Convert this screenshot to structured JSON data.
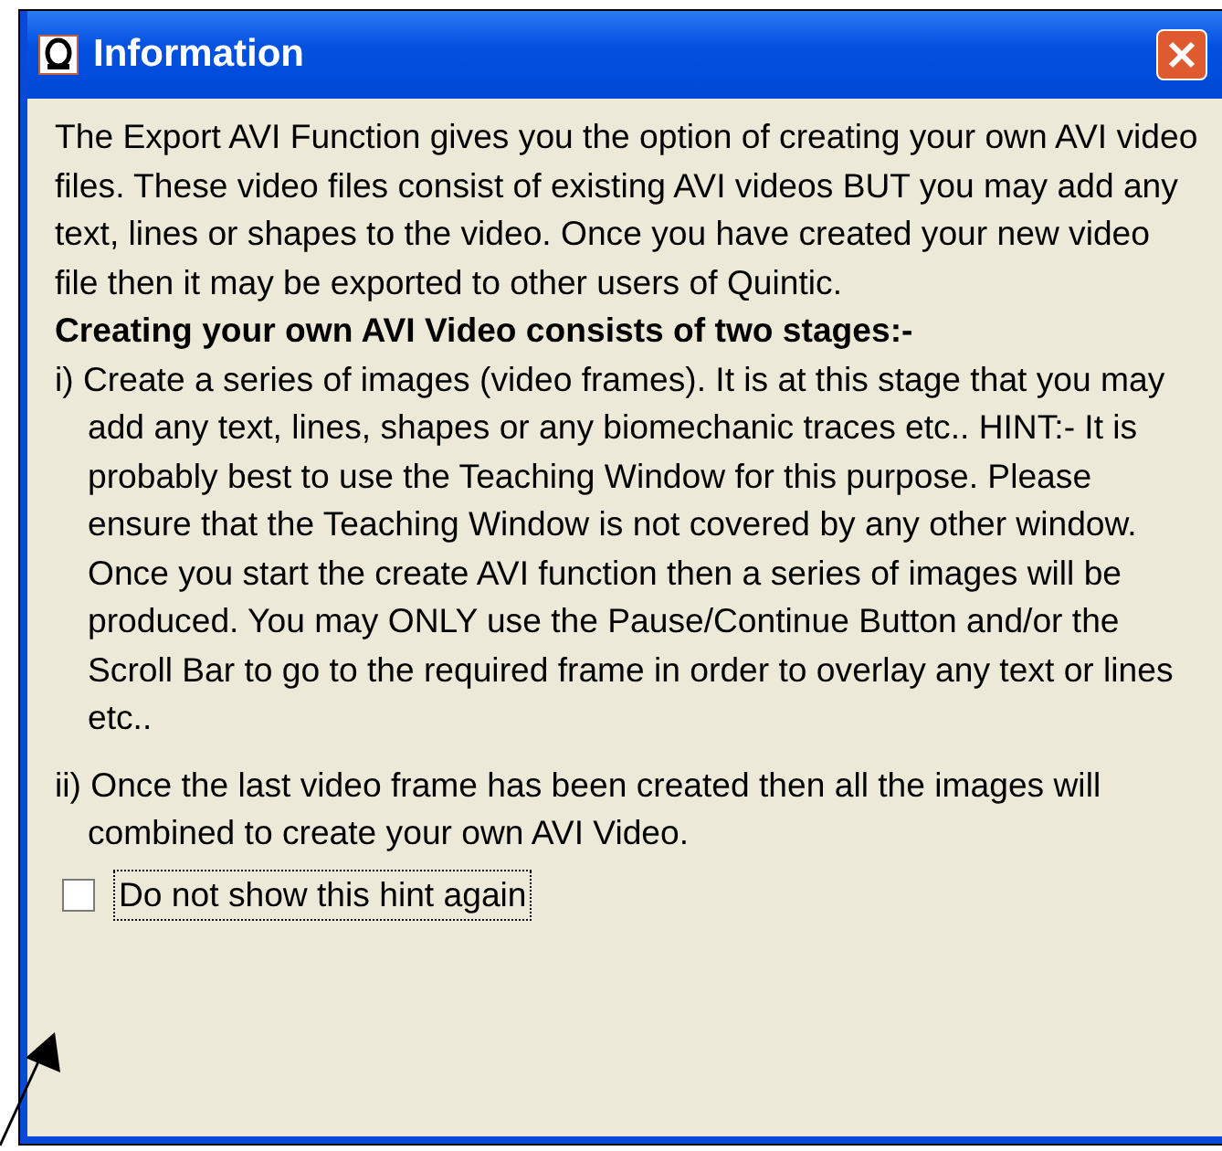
{
  "window": {
    "title": "Information"
  },
  "intro": "The Export AVI Function gives you the option of creating your own AVI video files. These video files consist of existing AVI videos BUT you may add any text, lines or shapes to the video. Once you have created your new video file then it may be exported to other users of Quintic.",
  "heading": "Creating your own AVI Video consists of two stages:-",
  "steps": [
    {
      "text": "i) Create a series of images (video frames). It is at this stage that you may add any text, lines, shapes or any biomechanic traces etc.. HINT:- It is probably best to use the Teaching Window for this purpose. Please ensure that the Teaching Window is not covered by any other window. Once you start the create AVI function then a series of images will be produced. You may ONLY use the Pause/Continue Button and/or the Scroll Bar to go to the required frame in order to overlay any text or lines etc.."
    },
    {
      "text": "ii) Once the last video frame has been created then all the images will combined to create your own AVI Video."
    }
  ],
  "checkbox": {
    "label": "Do not show this hint again",
    "checked": false
  }
}
